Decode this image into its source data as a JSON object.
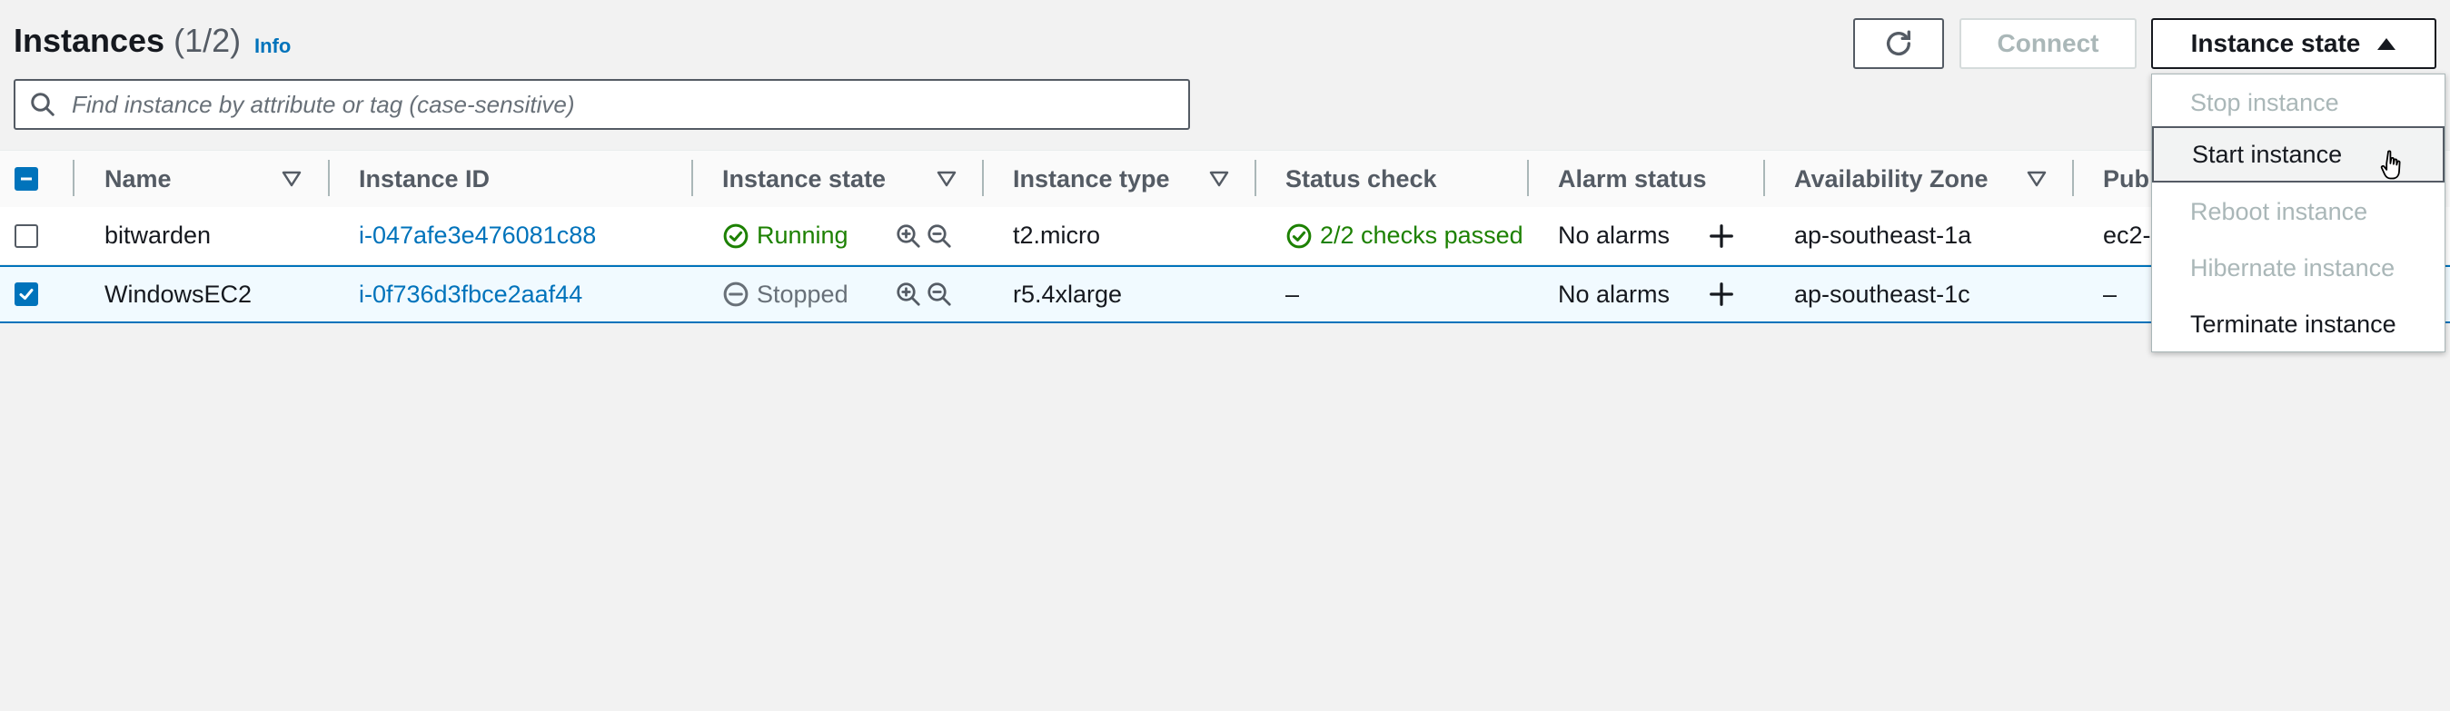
{
  "header": {
    "title": "Instances",
    "count": "(1/2)",
    "info": "Info",
    "connect_label": "Connect",
    "instance_state_label": "Instance state"
  },
  "search": {
    "placeholder": "Find instance by attribute or tag (case-sensitive)",
    "value": ""
  },
  "table": {
    "columns": [
      "Name",
      "Instance ID",
      "Instance state",
      "Instance type",
      "Status check",
      "Alarm status",
      "Availability Zone",
      "Pub"
    ],
    "rows": [
      {
        "selected": false,
        "name": "bitwarden",
        "instance_id": "i-047afe3e476081c88",
        "state": "Running",
        "type": "t2.micro",
        "status_check": "2/2 checks passed",
        "alarm_status": "No alarms",
        "az": "ap-southeast-1a",
        "public": "ec2-"
      },
      {
        "selected": true,
        "name": "WindowsEC2",
        "instance_id": "i-0f736d3fbce2aaf44",
        "state": "Stopped",
        "type": "r5.4xlarge",
        "status_check": "–",
        "alarm_status": "No alarms",
        "az": "ap-southeast-1c",
        "public": "–"
      }
    ]
  },
  "dropdown": {
    "items": [
      {
        "label": "Stop instance",
        "enabled": false
      },
      {
        "label": "Start instance",
        "enabled": true
      },
      {
        "label": "Reboot instance",
        "enabled": false
      },
      {
        "label": "Hibernate instance",
        "enabled": false
      },
      {
        "label": "Terminate instance",
        "enabled": true
      }
    ]
  },
  "colors": {
    "link": "#0073bb",
    "success": "#1d8102",
    "muted": "#687078",
    "selected_row": "#f1faff"
  }
}
